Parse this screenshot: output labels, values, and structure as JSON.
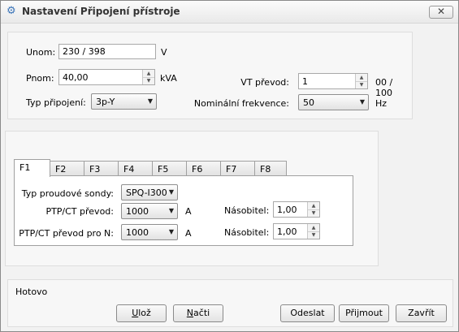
{
  "window": {
    "title": "Nastavení Připojení přístroje",
    "close_glyph": "✕"
  },
  "top": {
    "unom": {
      "label": "Unom:",
      "value": "230 / 398",
      "unit": "V"
    },
    "pnom": {
      "label": "Pnom:",
      "value": "40,00",
      "unit": "kVA"
    },
    "typ": {
      "label": "Typ připojení:",
      "value": "3p-Y"
    },
    "vt": {
      "label": "VT převod:",
      "value": "1",
      "suffix": "00 / 100"
    },
    "freq": {
      "label": "Nominální frekvence:",
      "value": "50",
      "unit": "Hz"
    }
  },
  "tabs": [
    "F1",
    "F2",
    "F3",
    "F4",
    "F5",
    "F6",
    "F7",
    "F8"
  ],
  "active_tab": "F1",
  "tab_page": {
    "sonda": {
      "label": "Typ proudové sondy:",
      "value": "SPQ-I300"
    },
    "ptp": {
      "label": "PTP/CT převod:",
      "value": "1000",
      "unit": "A"
    },
    "ptpn": {
      "label": "PTP/CT převod pro N:",
      "value": "1000",
      "unit": "A"
    },
    "nas1": {
      "label": "Násobitel:",
      "value": "1,00"
    },
    "nas2": {
      "label": "Násobitel:",
      "value": "1,00"
    }
  },
  "status": "Hotovo",
  "buttons": {
    "uloz": {
      "first": "U",
      "rest": "lož"
    },
    "nacti": {
      "first": "N",
      "rest": "ačti"
    },
    "odeslat": "Odeslat",
    "prijmout": "Přijmout",
    "zavrit": "Zavřít"
  }
}
